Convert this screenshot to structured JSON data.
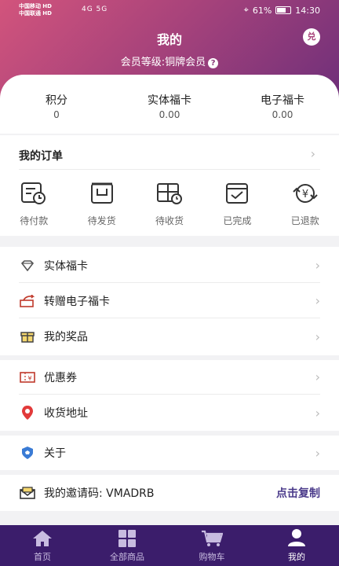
{
  "status_bar": {
    "carrier1": "中国移动",
    "carrier2": "中国联通",
    "net1": "HD",
    "net2": "HD",
    "signal": "4G 5G",
    "battery": "61%",
    "time": "14:30"
  },
  "header": {
    "title": "我的",
    "exchange_icon_text": "兑",
    "member_level": "会员等级:铜牌会员",
    "help_mark": "?"
  },
  "stats": [
    {
      "label": "积分",
      "value": "0"
    },
    {
      "label": "实体福卡",
      "value": "0.00"
    },
    {
      "label": "电子福卡",
      "value": "0.00"
    }
  ],
  "orders": {
    "title": "我的订单",
    "items": [
      {
        "label": "待付款",
        "icon": "pending-payment-icon"
      },
      {
        "label": "待发货",
        "icon": "pending-shipment-icon"
      },
      {
        "label": "待收货",
        "icon": "pending-receipt-icon"
      },
      {
        "label": "已完成",
        "icon": "completed-icon"
      },
      {
        "label": "已退款",
        "icon": "refunded-icon"
      }
    ]
  },
  "group1": [
    {
      "label": "实体福卡",
      "icon": "diamond-icon"
    },
    {
      "label": "转赠电子福卡",
      "icon": "transfer-card-icon"
    },
    {
      "label": "我的奖品",
      "icon": "gift-icon"
    }
  ],
  "group2": [
    {
      "label": "优惠券",
      "icon": "coupon-icon"
    },
    {
      "label": "收货地址",
      "icon": "location-icon"
    }
  ],
  "group3": [
    {
      "label": "关于",
      "icon": "shield-icon"
    }
  ],
  "invite": {
    "label": "我的邀请码:",
    "code": "VMADRB",
    "copy": "点击复制"
  },
  "tabbar": [
    {
      "label": "首页",
      "icon": "home-icon"
    },
    {
      "label": "全部商品",
      "icon": "grid-icon"
    },
    {
      "label": "购物车",
      "icon": "cart-icon"
    },
    {
      "label": "我的",
      "icon": "user-icon",
      "active": true
    }
  ],
  "colors": {
    "accent": "#a8437b",
    "tabbar": "#3b1d6b",
    "link": "#4a3a8a"
  }
}
